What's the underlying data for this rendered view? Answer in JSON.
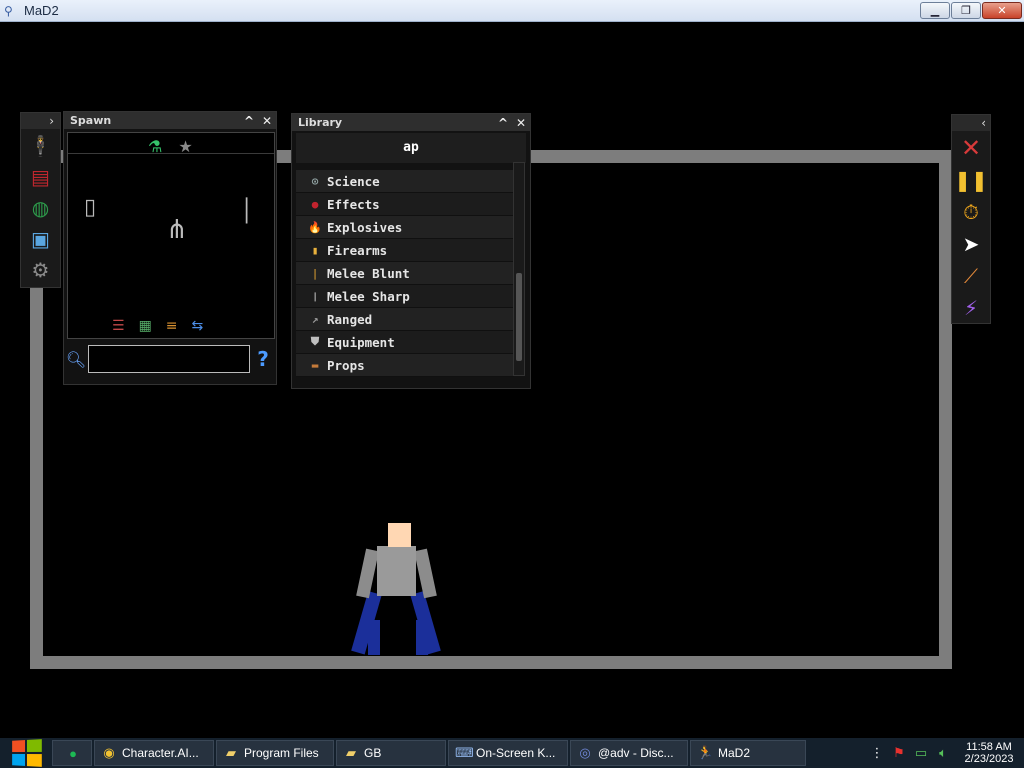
{
  "window": {
    "title": "MaD2",
    "minimize": "▁",
    "maximize": "❐",
    "close": "✕"
  },
  "left_panel": {
    "collapse": "›"
  },
  "spawn": {
    "title": "Spawn",
    "minimize": "^",
    "close": "✕",
    "search_value": "",
    "help": "?"
  },
  "library": {
    "title": "Library",
    "minimize": "^",
    "close": "✕",
    "search": "ap",
    "items": [
      {
        "label": "Science",
        "icon": "⊙",
        "color": "#8fa0a0"
      },
      {
        "label": "Effects",
        "icon": "●",
        "color": "#c2232e"
      },
      {
        "label": "Explosives",
        "icon": "🔥",
        "color": "#ff8a1c"
      },
      {
        "label": "Firearms",
        "icon": "▮",
        "color": "#e8b13c"
      },
      {
        "label": "Melee Blunt",
        "icon": "|",
        "color": "#b8862e"
      },
      {
        "label": "Melee Sharp",
        "icon": "❘",
        "color": "#e0e0e0"
      },
      {
        "label": "Ranged",
        "icon": "↗",
        "color": "#9a9a9a"
      },
      {
        "label": "Equipment",
        "icon": "⛊",
        "color": "#bfbfbf"
      },
      {
        "label": "Props",
        "icon": "▬",
        "color": "#c47a3a"
      }
    ]
  },
  "right_panel": {
    "collapse": "‹"
  },
  "taskbar": {
    "items": [
      {
        "label": "Character.AI...",
        "icon": "◉",
        "color": "#f1c232"
      },
      {
        "label": "Program Files",
        "icon": "▰",
        "color": "#f0cf6a"
      },
      {
        "label": "GB",
        "icon": "▰",
        "color": "#f0cf6a"
      },
      {
        "label": "On-Screen K...",
        "icon": "⌨",
        "color": "#8fb4e8"
      },
      {
        "label": "@adv - Disc...",
        "icon": "◎",
        "color": "#7289da"
      },
      {
        "label": "MaD2",
        "icon": "🏃",
        "color": "#8fa6d6"
      }
    ],
    "time": "11:58 AM",
    "date": "2/23/2023"
  }
}
